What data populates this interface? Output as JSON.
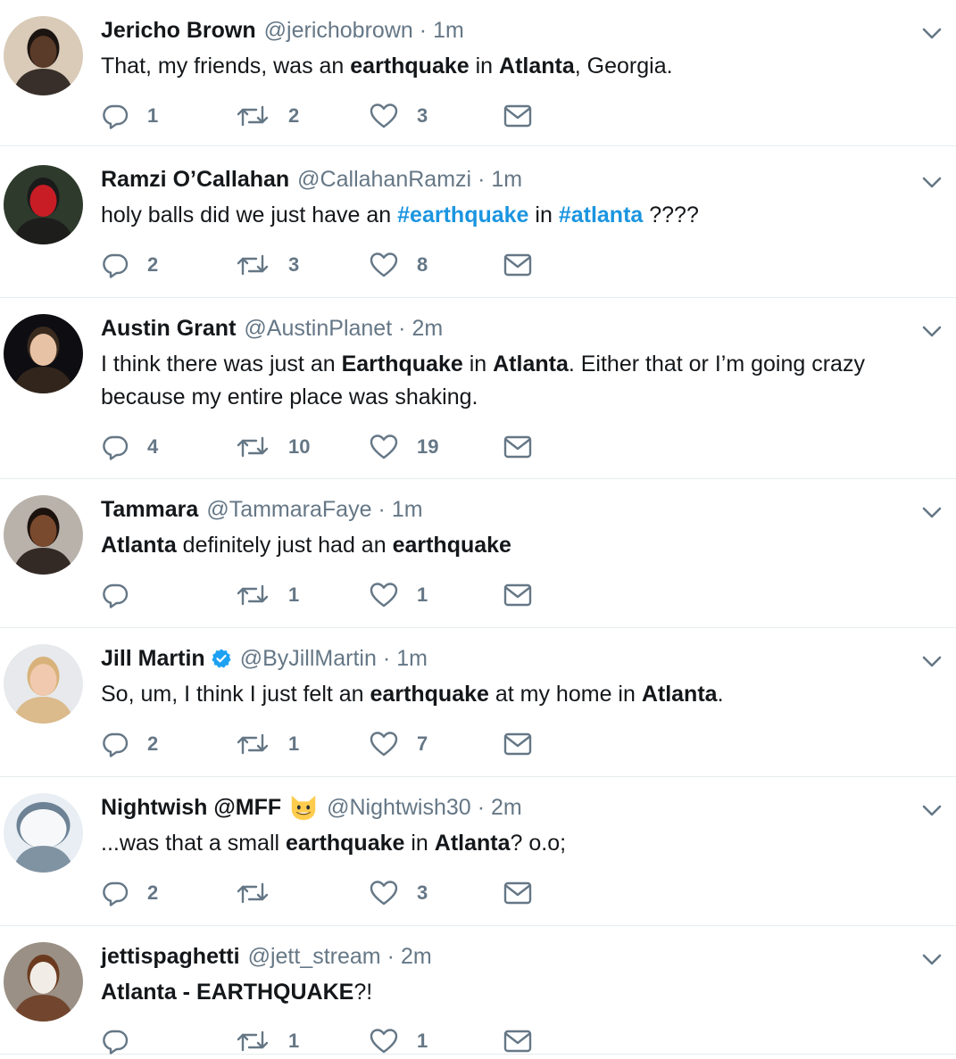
{
  "tweets": [
    {
      "name": "Jericho Brown",
      "handle": "@jerichobrown",
      "time": "1m",
      "verified": false,
      "name_emoji": "",
      "text_segments": [
        {
          "t": "That, my friends, was an ",
          "s": "n"
        },
        {
          "t": "earthquake",
          "s": "b"
        },
        {
          "t": " in ",
          "s": "n"
        },
        {
          "t": "Atlanta",
          "s": "b"
        },
        {
          "t": ", Georgia.",
          "s": "n"
        }
      ],
      "replies": "1",
      "retweets": "2",
      "likes": "3",
      "avatar": {
        "bg": "#d9cbb8",
        "skin": "#5a3a28",
        "hair": "#1b1410"
      }
    },
    {
      "name": "Ramzi O’Callahan",
      "handle": "@CallahanRamzi",
      "time": "1m",
      "verified": false,
      "name_emoji": "",
      "text_segments": [
        {
          "t": "holy balls did we just have an ",
          "s": "n"
        },
        {
          "t": "#earthquake",
          "s": "h"
        },
        {
          "t": " in ",
          "s": "n"
        },
        {
          "t": "#atlanta",
          "s": "h"
        },
        {
          "t": " ????",
          "s": "n"
        }
      ],
      "replies": "2",
      "retweets": "3",
      "likes": "8",
      "avatar": {
        "bg": "#2e3a2c",
        "skin": "#c81d25",
        "hair": "#1a1a1a"
      }
    },
    {
      "name": "Austin Grant",
      "handle": "@AustinPlanet",
      "time": "2m",
      "verified": false,
      "name_emoji": "",
      "text_segments": [
        {
          "t": "I think there was just an ",
          "s": "n"
        },
        {
          "t": "Earthquake",
          "s": "b"
        },
        {
          "t": " in ",
          "s": "n"
        },
        {
          "t": "Atlanta",
          "s": "b"
        },
        {
          "t": ". Either that or I’m going crazy because my entire place was shaking.",
          "s": "n"
        }
      ],
      "replies": "4",
      "retweets": "10",
      "likes": "19",
      "avatar": {
        "bg": "#0d0d12",
        "skin": "#e8c2a4",
        "hair": "#3a2a1e"
      }
    },
    {
      "name": "Tammara",
      "handle": "@TammaraFaye",
      "time": "1m",
      "verified": false,
      "name_emoji": "",
      "text_segments": [
        {
          "t": "Atlanta",
          "s": "b"
        },
        {
          "t": " definitely just had an ",
          "s": "n"
        },
        {
          "t": "earthquake",
          "s": "b"
        }
      ],
      "replies": "",
      "retweets": "1",
      "likes": "1",
      "avatar": {
        "bg": "#b9b2ab",
        "skin": "#7a4a2e",
        "hair": "#1c120d"
      }
    },
    {
      "name": "Jill Martin",
      "handle": "@ByJillMartin",
      "time": "1m",
      "verified": true,
      "name_emoji": "",
      "text_segments": [
        {
          "t": "So, um, I think I just felt an ",
          "s": "n"
        },
        {
          "t": "earthquake",
          "s": "b"
        },
        {
          "t": " at my home in ",
          "s": "n"
        },
        {
          "t": "Atlanta",
          "s": "b"
        },
        {
          "t": ".",
          "s": "n"
        }
      ],
      "replies": "2",
      "retweets": "1",
      "likes": "7",
      "avatar": {
        "bg": "#e7e9ec",
        "skin": "#f0c9ae",
        "hair": "#d8b27a"
      }
    },
    {
      "name": "Nightwish @MFF",
      "handle": "@Nightwish30",
      "time": "2m",
      "verified": false,
      "name_emoji": "grinning-cat-emoji",
      "text_segments": [
        {
          "t": "...was that a small ",
          "s": "n"
        },
        {
          "t": "earthquake",
          "s": "b"
        },
        {
          "t": " in ",
          "s": "n"
        },
        {
          "t": "Atlanta",
          "s": "b"
        },
        {
          "t": "? o.o;",
          "s": "n"
        }
      ],
      "replies": "2",
      "retweets": "",
      "likes": "3",
      "avatar": {
        "bg": "#e8eef3",
        "skin": "#f6f8fa",
        "hair": "#6d8294"
      }
    },
    {
      "name": "jettispaghetti",
      "handle": "@jett_stream",
      "time": "2m",
      "verified": false,
      "name_emoji": "",
      "text_segments": [
        {
          "t": "Atlanta - EARTHQUAKE",
          "s": "b"
        },
        {
          "t": "?!",
          "s": "n"
        }
      ],
      "replies": "",
      "retweets": "1",
      "likes": "1",
      "avatar": {
        "bg": "#9a9085",
        "skin": "#f1ece6",
        "hair": "#6b3a1e"
      }
    }
  ],
  "colors": {
    "link": "#1b95e0",
    "muted": "#657786",
    "text": "#14171a",
    "verified": "#1da1f2",
    "divider": "#e6ecf0"
  },
  "icons": {
    "reply": "reply-icon",
    "retweet": "retweet-icon",
    "like": "heart-icon",
    "dm": "envelope-icon",
    "menu": "chevron-down-icon",
    "verified": "verified-badge-icon"
  }
}
